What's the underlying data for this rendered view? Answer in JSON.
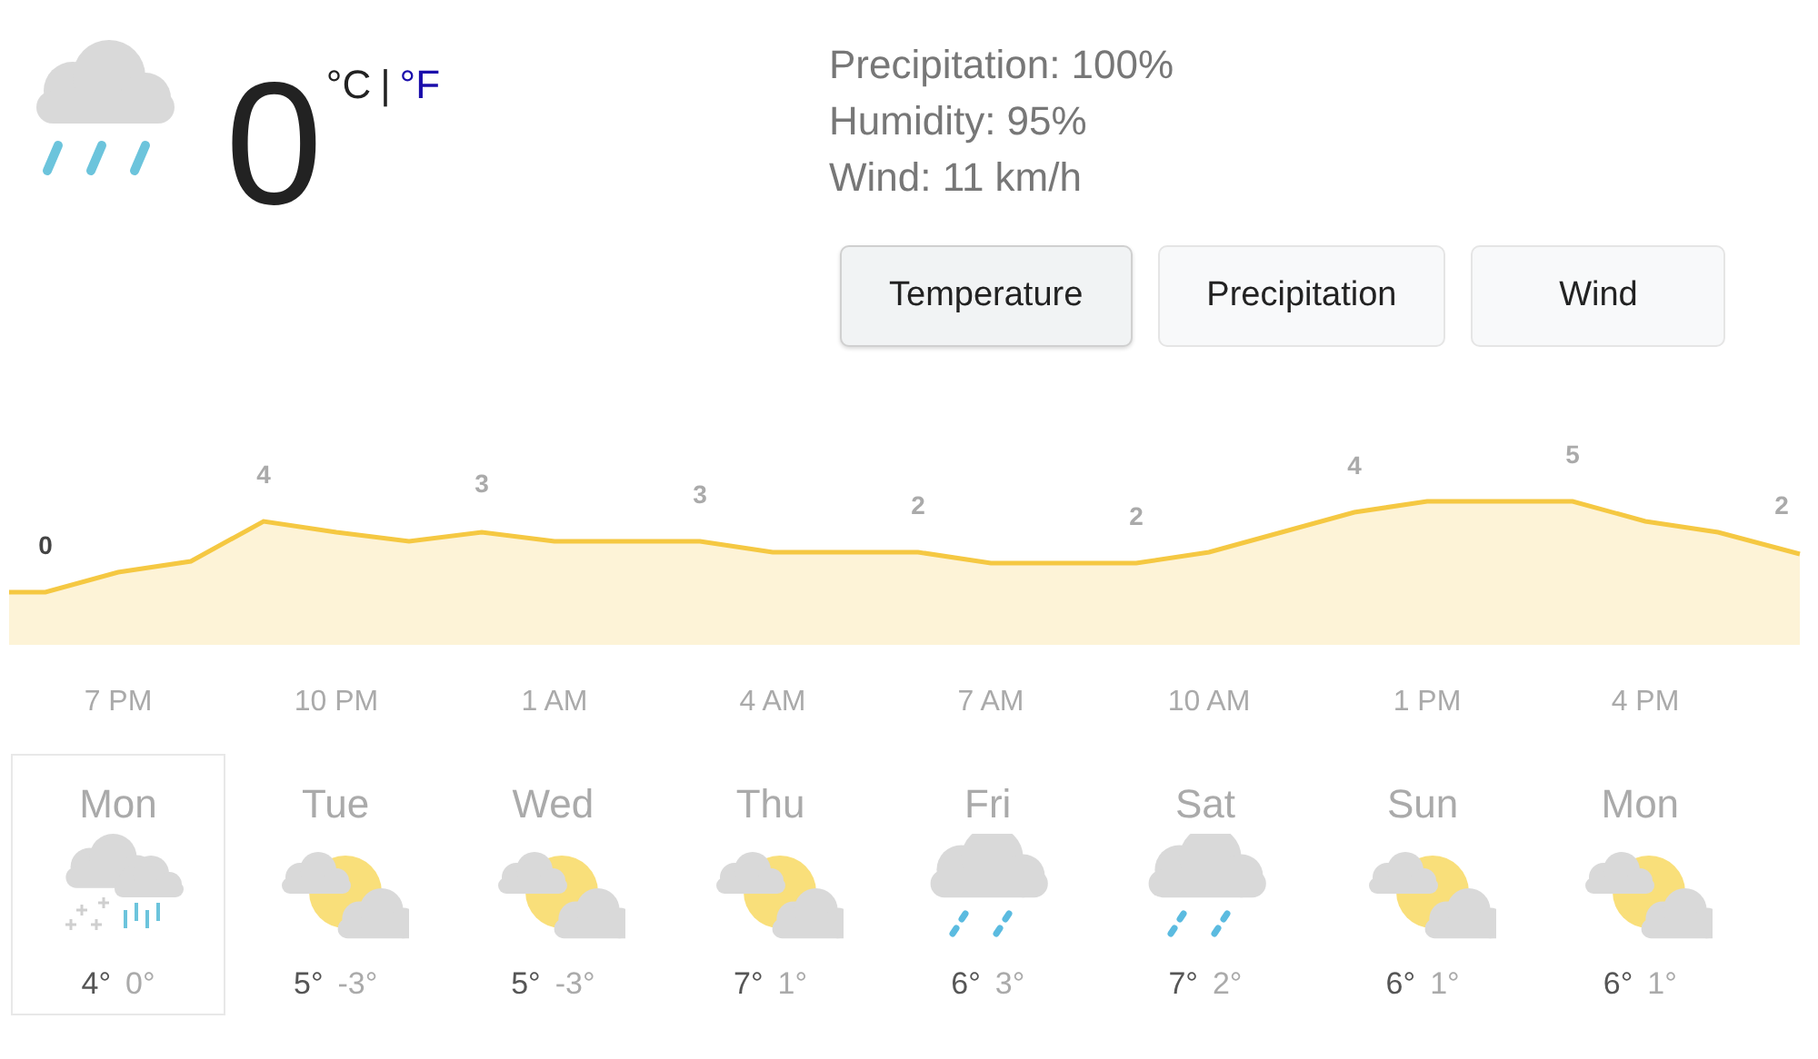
{
  "current": {
    "kind": "rain",
    "temperature": "0",
    "units": [
      {
        "label": "°C",
        "selected": true
      },
      {
        "label": "|",
        "kind": "separator"
      },
      {
        "label": "°F",
        "selected": false
      }
    ],
    "details": [
      "Precipitation: 100%",
      "Humidity: 95%",
      "Wind: 11 km/h"
    ]
  },
  "tabs": [
    {
      "label": "Temperature",
      "selected": true
    },
    {
      "label": "Precipitation",
      "selected": false
    },
    {
      "label": "Wind",
      "selected": false
    }
  ],
  "chart": {
    "point_labels": [
      "0",
      "4",
      "3",
      "3",
      "2",
      "2",
      "4",
      "5",
      "2"
    ],
    "time_labels": [
      "7 PM",
      "10 PM",
      "1 AM",
      "4 AM",
      "7 AM",
      "10 AM",
      "1 PM",
      "4 PM"
    ]
  },
  "forecast": [
    {
      "day": "Mon",
      "kind": "sleet",
      "high": "4°",
      "low": "0°",
      "selected": true
    },
    {
      "day": "Tue",
      "kind": "partly_cloudy",
      "high": "5°",
      "low": "-3°",
      "selected": false
    },
    {
      "day": "Wed",
      "kind": "partly_cloudy",
      "high": "5°",
      "low": "-3°",
      "selected": false
    },
    {
      "day": "Thu",
      "kind": "partly_cloudy",
      "high": "7°",
      "low": "1°",
      "selected": false
    },
    {
      "day": "Fri",
      "kind": "showers",
      "high": "6°",
      "low": "3°",
      "selected": false
    },
    {
      "day": "Sat",
      "kind": "showers",
      "high": "7°",
      "low": "2°",
      "selected": false
    },
    {
      "day": "Sun",
      "kind": "partly_cloudy",
      "high": "6°",
      "low": "1°",
      "selected": false
    },
    {
      "day": "Mon",
      "kind": "partly_cloudy",
      "high": "6°",
      "low": "1°",
      "selected": false
    }
  ]
}
